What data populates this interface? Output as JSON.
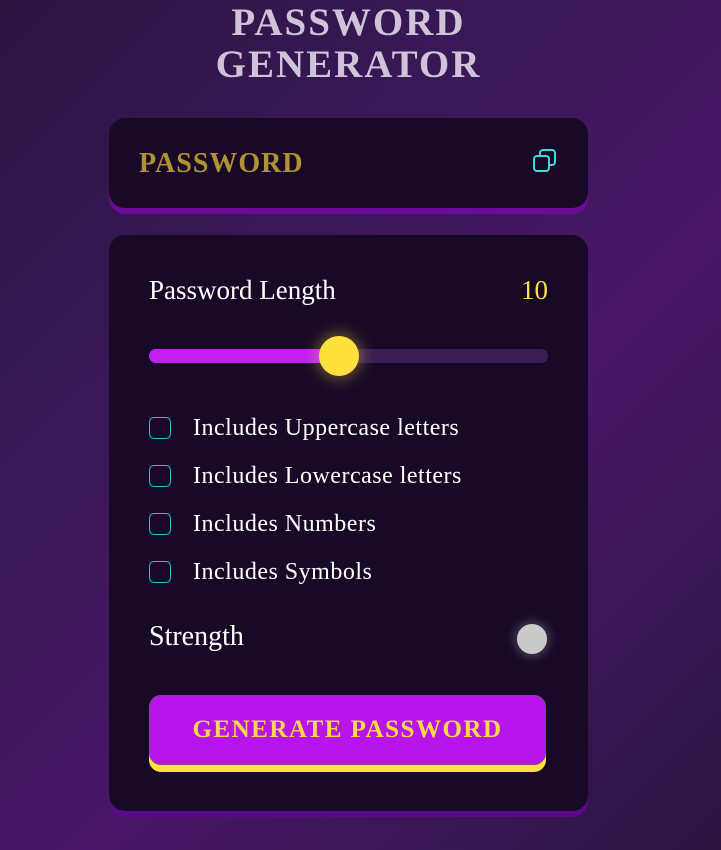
{
  "header": {
    "title_line1": "PASSWORD",
    "title_line2": "GENERATOR"
  },
  "password_display": {
    "text": "PASSWORD",
    "copy_icon": "copy-icon"
  },
  "length": {
    "label": "Password Length",
    "value": "10",
    "slider_fraction": 0.475
  },
  "options": [
    {
      "label": "Includes Uppercase letters",
      "checked": false
    },
    {
      "label": "Includes Lowercase letters",
      "checked": false
    },
    {
      "label": "Includes Numbers",
      "checked": false
    },
    {
      "label": "Includes Symbols",
      "checked": false
    }
  ],
  "strength": {
    "label": "Strength",
    "indicator_color": "#cacaca"
  },
  "generate_button": {
    "label": "GENERATE PASSWORD"
  },
  "colors": {
    "accent_purple": "#c21ef2",
    "accent_yellow": "#ffe03c",
    "checkbox_teal": "#2ec9cc",
    "password_gold": "#b09235",
    "card_bg": "#180a27"
  }
}
